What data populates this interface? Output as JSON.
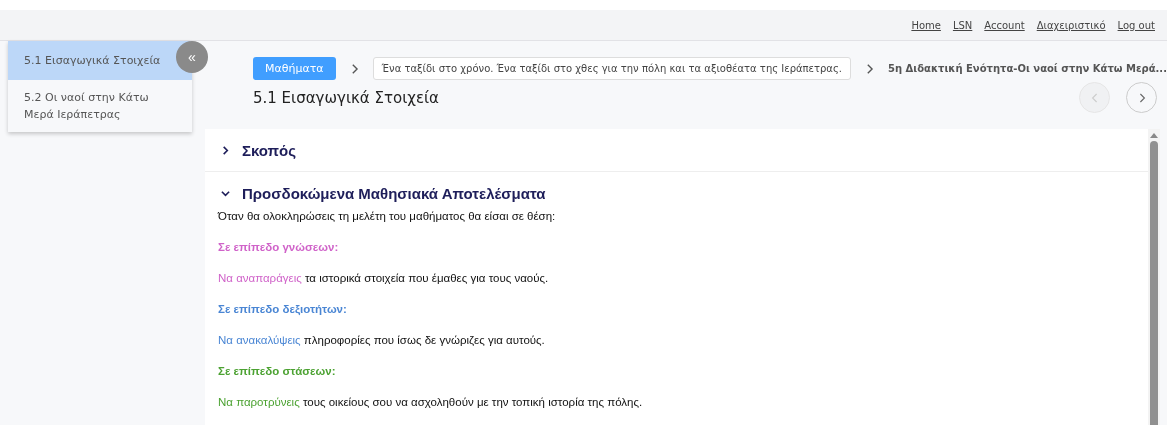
{
  "top_links": [
    "Home",
    "LSN",
    "Account",
    "Διαχειριστικό",
    "Log out"
  ],
  "sidebar": {
    "items": [
      {
        "label": "5.1 Εισαγωγικά Στοιχεία",
        "selected": true
      },
      {
        "label": "5.2 Οι ναοί στην Κάτω Μερά Ιεράπετρας",
        "selected": false
      }
    ],
    "collapse_icon": "«"
  },
  "breadcrumb": [
    {
      "kind": "button",
      "label": "Μαθήματα"
    },
    {
      "kind": "box",
      "label": "Ένα ταξίδι στο χρόνο. Ένα ταξίδι στο χθες για την πόλη και τα αξιοθέατα της Ιεράπετρας."
    },
    {
      "kind": "text",
      "label": "5η Διδακτική Ενότητα-Οι ναοί στην Κάτω Μερά..."
    }
  ],
  "page_title": "5.1 Εισαγωγικά Στοιχεία",
  "nav": {
    "previous": {
      "disabled": true
    },
    "next": {
      "disabled": false
    }
  },
  "sections": [
    {
      "title": "Σκοπός",
      "expanded": false
    },
    {
      "title": "Προσδοκώμενα Μαθησιακά Αποτελέσματα",
      "expanded": true,
      "content": [
        {
          "kind": "plain",
          "text": "Όταν θα ολοκληρώσεις τη μελέτη του μαθήματος θα είσαι σε θέση:"
        },
        {
          "kind": "heading",
          "text": "Σε επίπεδο γνώσεων:",
          "color": "#d063c9"
        },
        {
          "kind": "lead",
          "lead": "Να αναπαράγεις",
          "text": "τα ιστορικά στοιχεία που έμαθες για τους ναούς.",
          "color": "#d063c9"
        },
        {
          "kind": "heading",
          "text": "Σε επίπεδο δεξιοτήτων:",
          "color": "#4a86d4"
        },
        {
          "kind": "lead",
          "lead": "Να ανακαλύψεις",
          "text": "πληροφορίες που ίσως δε γνώριζες για αυτούς.",
          "color": "#4a86d4"
        },
        {
          "kind": "heading",
          "text": "Σε επίπεδο στάσεων:",
          "color": "#4ca232"
        },
        {
          "kind": "lead",
          "lead": "Να παροτρύνεις",
          "text": "τους οικείους σου να ασχοληθούν με την τοπική ιστορία της πόλης.",
          "color": "#4ca232"
        }
      ]
    }
  ]
}
